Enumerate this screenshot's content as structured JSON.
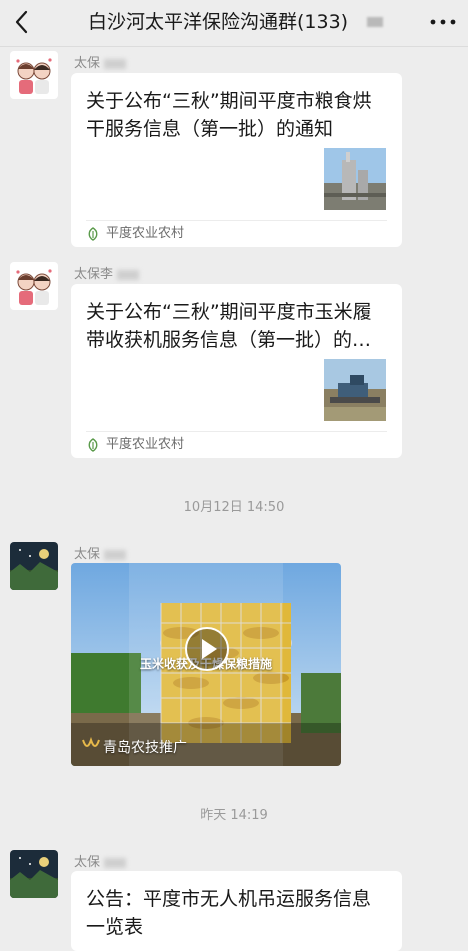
{
  "header": {
    "title": "白沙河太平洋保险沟通群(133)",
    "back_icon": "chevron-left-icon",
    "more_icon": "ellipsis-icon"
  },
  "messages": [
    {
      "sender": "太保",
      "type": "article",
      "title": "关于公布“三秋”期间平度市粮食烘干服务信息（第一批）的通知",
      "source": "平度农业农村"
    },
    {
      "sender": "太保李",
      "type": "article",
      "title": "关于公布“三秋”期间平度市玉米履带收获机服务信息（第一批）的通知",
      "source": "平度农业农村"
    },
    {
      "timestamp": "10月12日 14:50"
    },
    {
      "sender": "太保",
      "type": "video",
      "overlay_title": "玉米收获及干燥保粮措施",
      "channel": "青岛农技推广",
      "play_icon": "play-icon"
    },
    {
      "timestamp": "昨天 14:19"
    },
    {
      "sender": "太保",
      "type": "text",
      "text": "公告：平度市无人机吊运服务信息一览表"
    }
  ],
  "colors": {
    "background": "#ededed",
    "card": "#ffffff",
    "source_logo": "#5a9a4a"
  }
}
